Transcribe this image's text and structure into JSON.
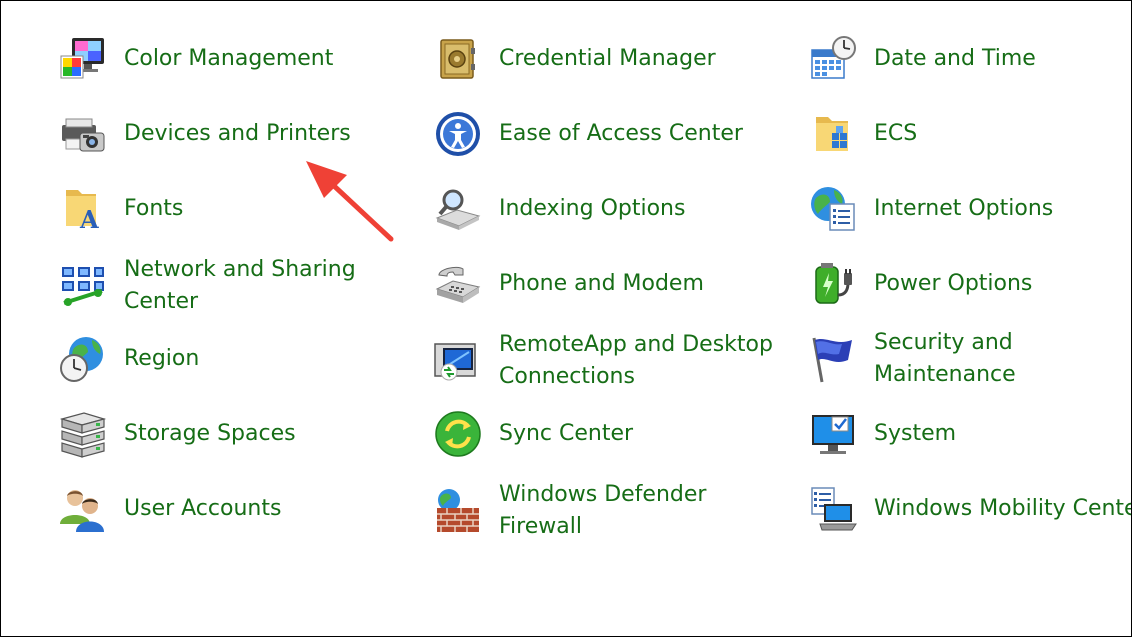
{
  "items": [
    {
      "label": "Color Management",
      "icon": "color-management-icon"
    },
    {
      "label": "Credential Manager",
      "icon": "credential-manager-icon"
    },
    {
      "label": "Date and Time",
      "icon": "date-time-icon"
    },
    {
      "label": "Devices and Printers",
      "icon": "devices-printers-icon"
    },
    {
      "label": "Ease of Access Center",
      "icon": "ease-of-access-icon"
    },
    {
      "label": "ECS",
      "icon": "folder-icon"
    },
    {
      "label": "Fonts",
      "icon": "fonts-icon"
    },
    {
      "label": "Indexing Options",
      "icon": "indexing-icon"
    },
    {
      "label": "Internet Options",
      "icon": "internet-options-icon"
    },
    {
      "label": "Network and Sharing\nCenter",
      "icon": "network-icon"
    },
    {
      "label": "Phone and Modem",
      "icon": "phone-icon"
    },
    {
      "label": "Power Options",
      "icon": "power-icon"
    },
    {
      "label": "Region",
      "icon": "region-icon"
    },
    {
      "label": "RemoteApp and Desktop\nConnections",
      "icon": "remoteapp-icon"
    },
    {
      "label": "Security and Maintenance",
      "icon": "security-flag-icon"
    },
    {
      "label": "Storage Spaces",
      "icon": "storage-icon"
    },
    {
      "label": "Sync Center",
      "icon": "sync-icon"
    },
    {
      "label": "System",
      "icon": "system-monitor-icon"
    },
    {
      "label": "User Accounts",
      "icon": "user-accounts-icon"
    },
    {
      "label": "Windows Defender\nFirewall",
      "icon": "firewall-icon"
    },
    {
      "label": "Windows Mobility Center",
      "icon": "mobility-center-icon"
    }
  ],
  "colors": {
    "link": "#166d16",
    "arrow": "#ef4136"
  }
}
